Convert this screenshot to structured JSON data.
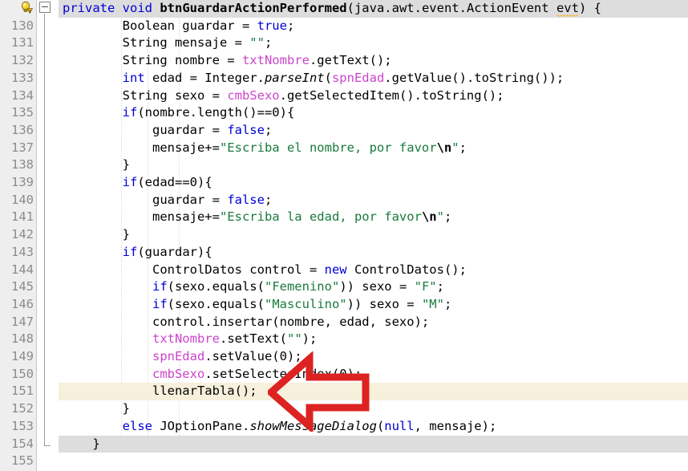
{
  "editor": {
    "language": "java",
    "first_line": 130,
    "last_line": 155,
    "highlight_color": "#f6f0dc",
    "fold_header_color": "#dddddd",
    "gutter_color": "#eeeeee",
    "keyword_color": "#0000d6",
    "field_color": "#cc44cc",
    "string_color": "#1a7a3c",
    "warning_underline_color": "#ffa800",
    "annotation_color": "#dd2222"
  },
  "gutter": {
    "hint_icon": "lightbulb-warning-icon",
    "fold_toggle": "−",
    "line_numbers": [
      "130",
      "131",
      "132",
      "133",
      "134",
      "135",
      "136",
      "137",
      "138",
      "139",
      "140",
      "141",
      "142",
      "143",
      "144",
      "145",
      "146",
      "147",
      "148",
      "149",
      "150",
      "151",
      "152",
      "153",
      "154",
      "155"
    ]
  },
  "code": {
    "method_signature": {
      "modifier": "private",
      "return_type": "void",
      "name": "btnGuardarActionPerformed",
      "params_open": "(java.awt.event.ActionEvent ",
      "param_warned": "evt",
      "params_close": ") {",
      "full_text": "private void btnGuardarActionPerformed(java.awt.event.ActionEvent evt) {"
    },
    "lines": [
      {
        "n": "130",
        "text": "        Boolean guardar = true;"
      },
      {
        "n": "131",
        "text": "        String mensaje = \"\";"
      },
      {
        "n": "132",
        "text": "        String nombre = txtNombre.getText();"
      },
      {
        "n": "133",
        "text": "        int edad = Integer.parseInt(spnEdad.getValue().toString());"
      },
      {
        "n": "134",
        "text": "        String sexo = cmbSexo.getSelectedItem().toString();"
      },
      {
        "n": "135",
        "text": "        if(nombre.length()==0){"
      },
      {
        "n": "136",
        "text": "            guardar = false;"
      },
      {
        "n": "137",
        "text": "            mensaje+=\"Escriba el nombre, por favor\\n\";"
      },
      {
        "n": "138",
        "text": "        }"
      },
      {
        "n": "139",
        "text": "        if(edad==0){"
      },
      {
        "n": "140",
        "text": "            guardar = false;"
      },
      {
        "n": "141",
        "text": "            mensaje+=\"Escriba la edad, por favor\\n\";"
      },
      {
        "n": "142",
        "text": "        }"
      },
      {
        "n": "143",
        "text": "        if(guardar){"
      },
      {
        "n": "144",
        "text": "            ControlDatos control = new ControlDatos();"
      },
      {
        "n": "145",
        "text": "            if(sexo.equals(\"Femenino\")) sexo = \"F\";"
      },
      {
        "n": "146",
        "text": "            if(sexo.equals(\"Masculino\")) sexo = \"M\";"
      },
      {
        "n": "147",
        "text": "            control.insertar(nombre, edad, sexo);"
      },
      {
        "n": "148",
        "text": "            txtNombre.setText(\"\");"
      },
      {
        "n": "149",
        "text": "            spnEdad.setValue(0);"
      },
      {
        "n": "150",
        "text": "            cmbSexo.setSelectedIndex(0);"
      },
      {
        "n": "151",
        "text": "            llenarTabla();"
      },
      {
        "n": "152",
        "text": "        }"
      },
      {
        "n": "153",
        "text": "        else JOptionPane.showMessageDialog(null, mensaje);"
      },
      {
        "n": "154",
        "text": "    }"
      },
      {
        "n": "155",
        "text": ""
      }
    ],
    "highlighted_line": "151",
    "highlighted_line_text": "llenarTabla();"
  },
  "annotation": {
    "type": "left-arrow",
    "target_line": "151",
    "target_text": "llenarTabla();",
    "color": "#dd2222"
  }
}
